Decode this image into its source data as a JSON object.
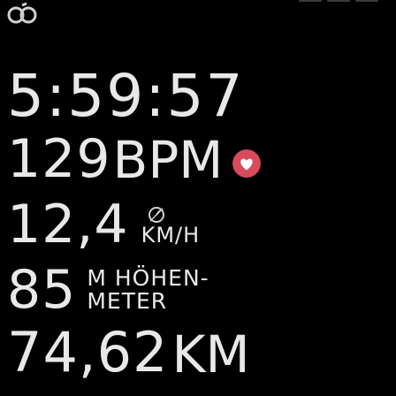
{
  "status": {
    "activity_icon": "running-figure-icon",
    "page_dots": 3
  },
  "metrics": {
    "time": "5:59:57",
    "heart_rate": {
      "value": "129",
      "unit": "BPM",
      "icon": "heart-icon"
    },
    "speed": {
      "value": "12,4",
      "icon": "pace-gauge-icon",
      "unit": "KM/H"
    },
    "altitude": {
      "value": "85",
      "label_line1": "M HÖHEN-",
      "label_line2": "METER"
    },
    "distance": {
      "value": "74,62",
      "unit": "KM"
    }
  },
  "colors": {
    "background": "#000000",
    "text": "#e8e8e8",
    "heart": "#d94a5c",
    "dots": "#3a3a3a"
  }
}
